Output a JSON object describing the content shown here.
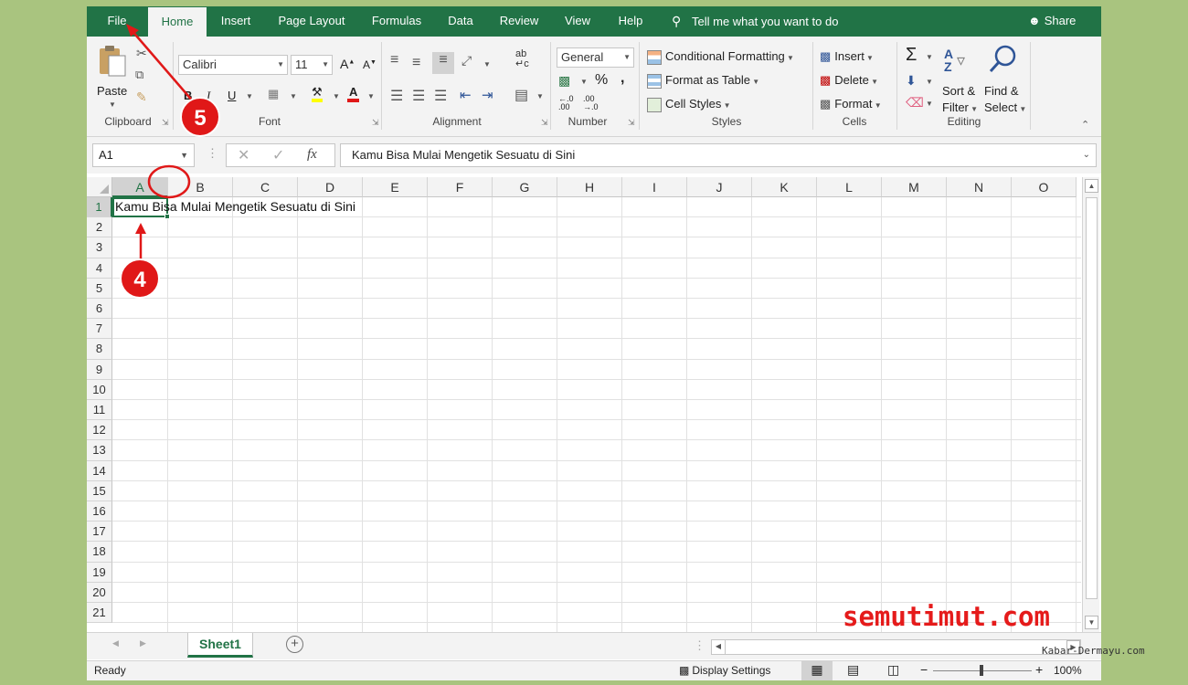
{
  "ribbon": {
    "tabs": [
      {
        "label": "File",
        "active": false
      },
      {
        "label": "Home",
        "active": true
      },
      {
        "label": "Insert",
        "active": false
      },
      {
        "label": "Page Layout",
        "active": false
      },
      {
        "label": "Formulas",
        "active": false
      },
      {
        "label": "Data",
        "active": false
      },
      {
        "label": "Review",
        "active": false
      },
      {
        "label": "View",
        "active": false
      },
      {
        "label": "Help",
        "active": false
      }
    ],
    "tell_me": "Tell me what you want to do",
    "share": "Share",
    "accent_color": "#217346",
    "clipboard": {
      "paste": "Paste",
      "label": "Clipboard"
    },
    "font": {
      "name": "Calibri",
      "size": "11",
      "bold": "B",
      "italic": "I",
      "underline": "U",
      "label": "Font"
    },
    "alignment": {
      "label": "Alignment"
    },
    "number": {
      "format": "General",
      "percent": "%",
      "comma": ",",
      "label": "Number"
    },
    "styles": {
      "conditional": "Conditional Formatting",
      "format_table": "Format as Table",
      "cell_styles": "Cell Styles",
      "label": "Styles"
    },
    "cells": {
      "insert": "Insert",
      "delete": "Delete",
      "format": "Format",
      "label": "Cells"
    },
    "editing": {
      "sort_filter_1": "Sort &",
      "sort_filter_2": "Filter",
      "find_select_1": "Find &",
      "find_select_2": "Select",
      "label": "Editing"
    }
  },
  "formula_bar": {
    "name_box": "A1",
    "fx": "fx",
    "content": "Kamu Bisa Mulai Mengetik Sesuatu di Sini"
  },
  "grid": {
    "columns": [
      "A",
      "B",
      "C",
      "D",
      "E",
      "F",
      "G",
      "H",
      "I",
      "J",
      "K",
      "L",
      "M",
      "N",
      "O"
    ],
    "rows": [
      "1",
      "2",
      "3",
      "4",
      "5",
      "6",
      "7",
      "8",
      "9",
      "10",
      "11",
      "12",
      "13",
      "14",
      "15",
      "16",
      "17",
      "18",
      "19",
      "20",
      "21"
    ],
    "cell_a1": "Kamu Bisa Mulai Mengetik Sesuatu di Sini"
  },
  "sheet_tabs": {
    "active": "Sheet1",
    "add": "+"
  },
  "status_bar": {
    "ready": "Ready",
    "display_settings": "Display Settings",
    "minus": "−",
    "plus": "+",
    "zoom": "100%"
  },
  "annotations": {
    "step4": "4",
    "step5": "5",
    "marker_color": "#e01818"
  },
  "watermark": {
    "brand": "semutimut.com",
    "credit": "Kabar-Dermayu.com"
  }
}
